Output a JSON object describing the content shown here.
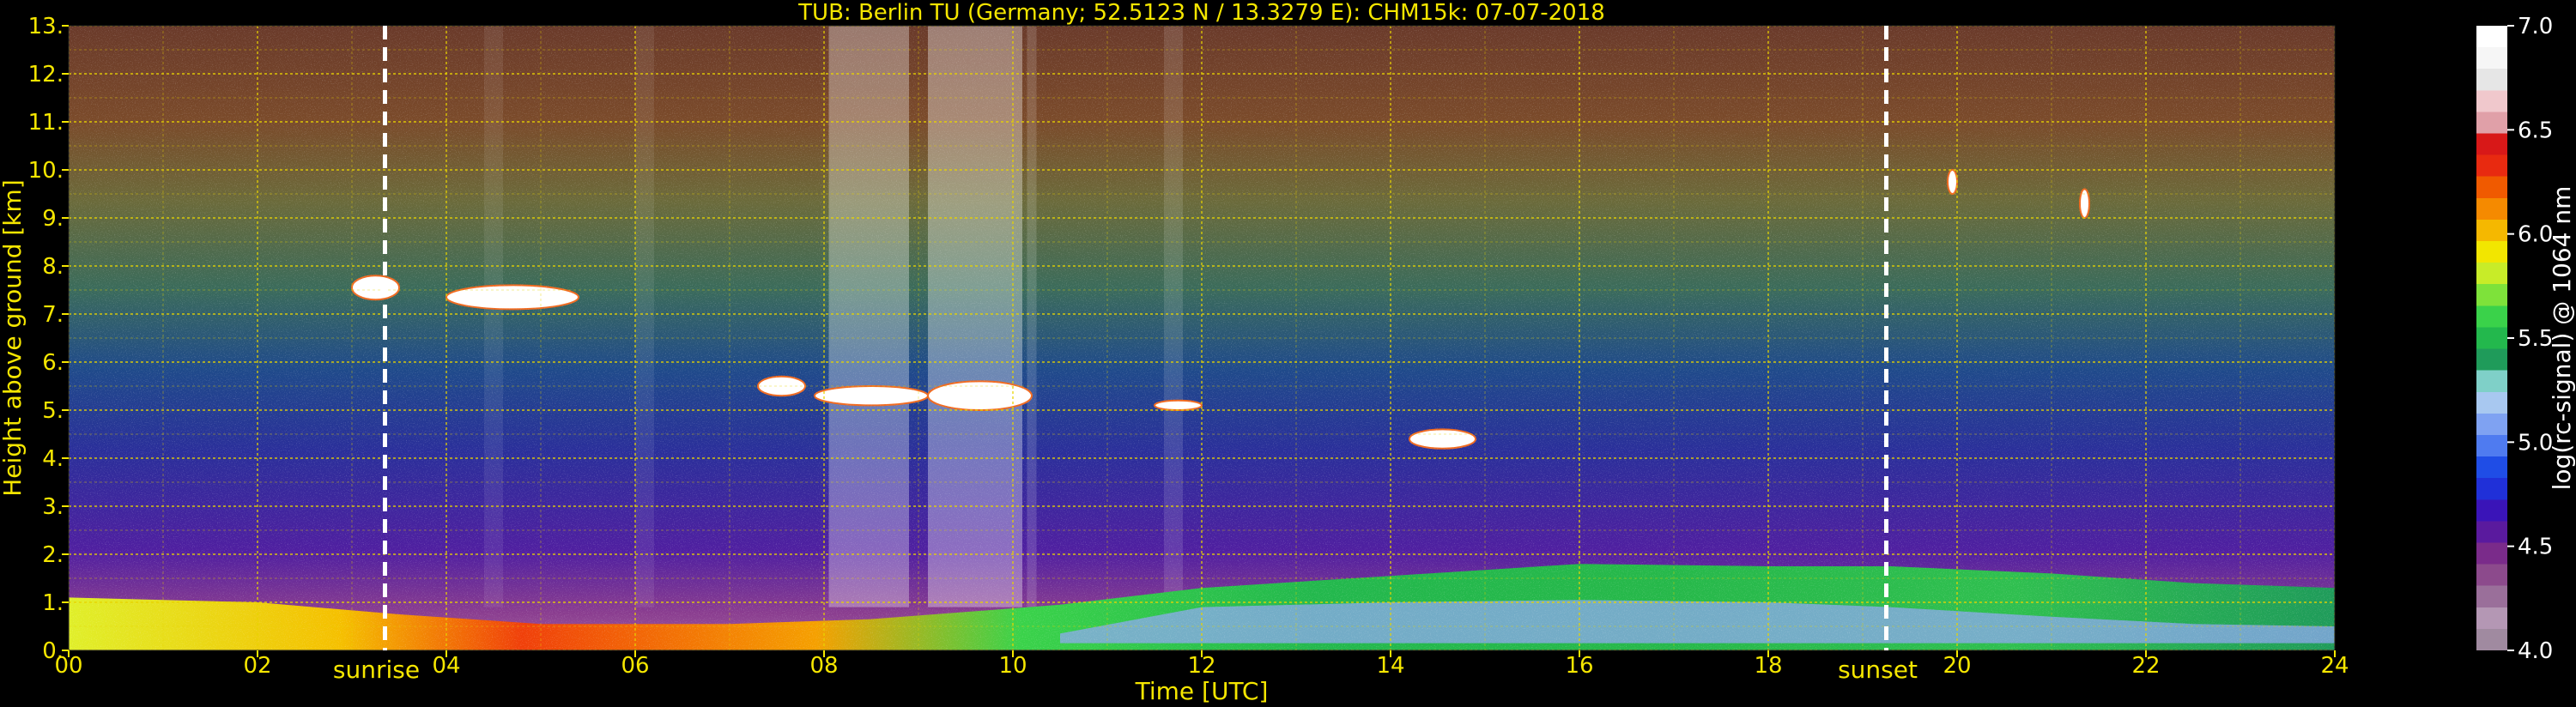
{
  "chart_data": {
    "type": "heatmap",
    "title": "TUB: Berlin TU (Germany; 52.5123 N / 13.3279 E):    CHM15k: 07-07-2018",
    "xlabel": "Time [UTC]",
    "ylabel": "Height above ground [km]",
    "xlim": [
      0,
      24
    ],
    "ylim": [
      0,
      13
    ],
    "x_ticks": [
      "00",
      "02",
      "04",
      "06",
      "08",
      "10",
      "12",
      "14",
      "16",
      "18",
      "20",
      "22",
      "24"
    ],
    "y_ticks": [
      "0.",
      "1.",
      "2.",
      "3.",
      "4.",
      "5.",
      "6.",
      "7.",
      "8.",
      "9.",
      "10.",
      "11.",
      "12.",
      "13."
    ],
    "grid": true,
    "colorbar": {
      "label": "log(rc-signal) @ 1064 nm",
      "range": [
        4.0,
        7.0
      ],
      "ticks": [
        "4.0",
        "4.5",
        "5.0",
        "5.5",
        "6.0",
        "6.5",
        "7.0"
      ],
      "colors": [
        "#a08aa0",
        "#b497b4",
        "#9a6f9a",
        "#8c4a8c",
        "#7a2b8a",
        "#5a1a9e",
        "#3a14b8",
        "#2030d8",
        "#1f4de6",
        "#4f7bf0",
        "#7fa2f2",
        "#a8c8f0",
        "#7fd0c8",
        "#1f9b5a",
        "#23b84d",
        "#3ad24a",
        "#7ee23a",
        "#c8ec28",
        "#f2e600",
        "#f5b800",
        "#f58a00",
        "#f05a00",
        "#e82a10",
        "#d81818",
        "#e0a0a8",
        "#f0c8cc",
        "#e6e6e6",
        "#f6f6f6",
        "#ffffff"
      ]
    },
    "markers": [
      {
        "label": "sunrise",
        "x": 3.35
      },
      {
        "label": "sunset",
        "x": 19.25
      }
    ],
    "boundary_layer": [
      {
        "x": 0,
        "top": 1.1
      },
      {
        "x": 2,
        "top": 1.0
      },
      {
        "x": 3.5,
        "top": 0.75
      },
      {
        "x": 5,
        "top": 0.55
      },
      {
        "x": 7,
        "top": 0.55
      },
      {
        "x": 8.5,
        "top": 0.65
      },
      {
        "x": 10.5,
        "top": 0.95
      },
      {
        "x": 12,
        "top": 1.3
      },
      {
        "x": 14,
        "top": 1.55
      },
      {
        "x": 16,
        "top": 1.8
      },
      {
        "x": 18,
        "top": 1.75
      },
      {
        "x": 19.3,
        "top": 1.75
      },
      {
        "x": 21,
        "top": 1.6
      },
      {
        "x": 22.5,
        "top": 1.4
      },
      {
        "x": 24,
        "top": 1.3
      }
    ],
    "cloud_layers": [
      {
        "x_start": 3.0,
        "x_end": 3.5,
        "y_low": 7.3,
        "y_high": 7.8
      },
      {
        "x_start": 4.0,
        "x_end": 5.4,
        "y_low": 7.1,
        "y_high": 7.6
      },
      {
        "x_start": 7.3,
        "x_end": 7.8,
        "y_low": 5.3,
        "y_high": 5.7
      },
      {
        "x_start": 7.9,
        "x_end": 9.1,
        "y_low": 5.1,
        "y_high": 5.5
      },
      {
        "x_start": 9.1,
        "x_end": 10.2,
        "y_low": 5.0,
        "y_high": 5.6
      },
      {
        "x_start": 11.5,
        "x_end": 12.0,
        "y_low": 5.0,
        "y_high": 5.2
      },
      {
        "x_start": 14.2,
        "x_end": 14.9,
        "y_low": 4.2,
        "y_high": 4.6
      },
      {
        "x_start": 19.9,
        "x_end": 20.0,
        "y_low": 9.5,
        "y_high": 10.0
      },
      {
        "x_start": 21.3,
        "x_end": 21.4,
        "y_low": 9.0,
        "y_high": 9.6
      }
    ]
  }
}
